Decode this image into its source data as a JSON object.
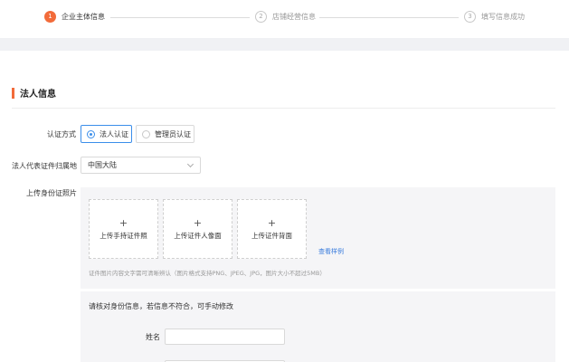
{
  "stepper": {
    "steps": [
      {
        "num": "1",
        "label": "企业主体信息",
        "state": "active"
      },
      {
        "num": "2",
        "label": "店铺经营信息",
        "state": "todo"
      },
      {
        "num": "3",
        "label": "填写信息成功",
        "state": "todo"
      }
    ]
  },
  "section": {
    "title": "法人信息"
  },
  "auth_method": {
    "label": "认证方式",
    "options": [
      {
        "label": "法人认证",
        "checked": true
      },
      {
        "label": "管理员认证",
        "checked": false
      }
    ]
  },
  "id_region": {
    "label": "法人代表证件归属地",
    "value": "中国大陆"
  },
  "id_photos": {
    "label": "上传身份证照片",
    "cards": [
      {
        "plus": "+",
        "text": "上传手持证件照"
      },
      {
        "plus": "+",
        "text": "上传证件人像面"
      },
      {
        "plus": "+",
        "text": "上传证件背面"
      }
    ],
    "sample_link": "查看样例",
    "hint": "证件图片内容文字需可清晰辨认（图片格式支持PNG、JPEG、JPG，图片大小不超过5MB）"
  },
  "verify": {
    "tip": "请核对身份信息，若信息不符合，可手动修改",
    "name_label": "姓名",
    "name_value": ""
  },
  "colors": {
    "accent": "#f26b3a",
    "link": "#3b7ddd",
    "radio_active": "#3b8eea"
  }
}
